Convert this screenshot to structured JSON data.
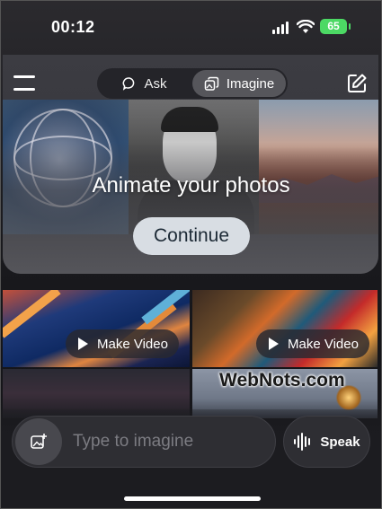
{
  "status_bar": {
    "time": "00:12",
    "battery": "65"
  },
  "nav": {
    "tabs": [
      {
        "label": "Ask",
        "icon": "chat-bubble-icon",
        "active": false
      },
      {
        "label": "Imagine",
        "icon": "image-stack-icon",
        "active": true
      }
    ]
  },
  "hero": {
    "title": "Animate your photos",
    "button_label": "Continue"
  },
  "tiles": [
    {
      "action_label": "Make Video"
    },
    {
      "action_label": "Make Video"
    }
  ],
  "watermark": "WebNots.com",
  "composer": {
    "placeholder": "Type to imagine",
    "speak_label": "Speak"
  },
  "colors": {
    "battery": "#4cd964",
    "continue_bg": "#d8dde3"
  }
}
